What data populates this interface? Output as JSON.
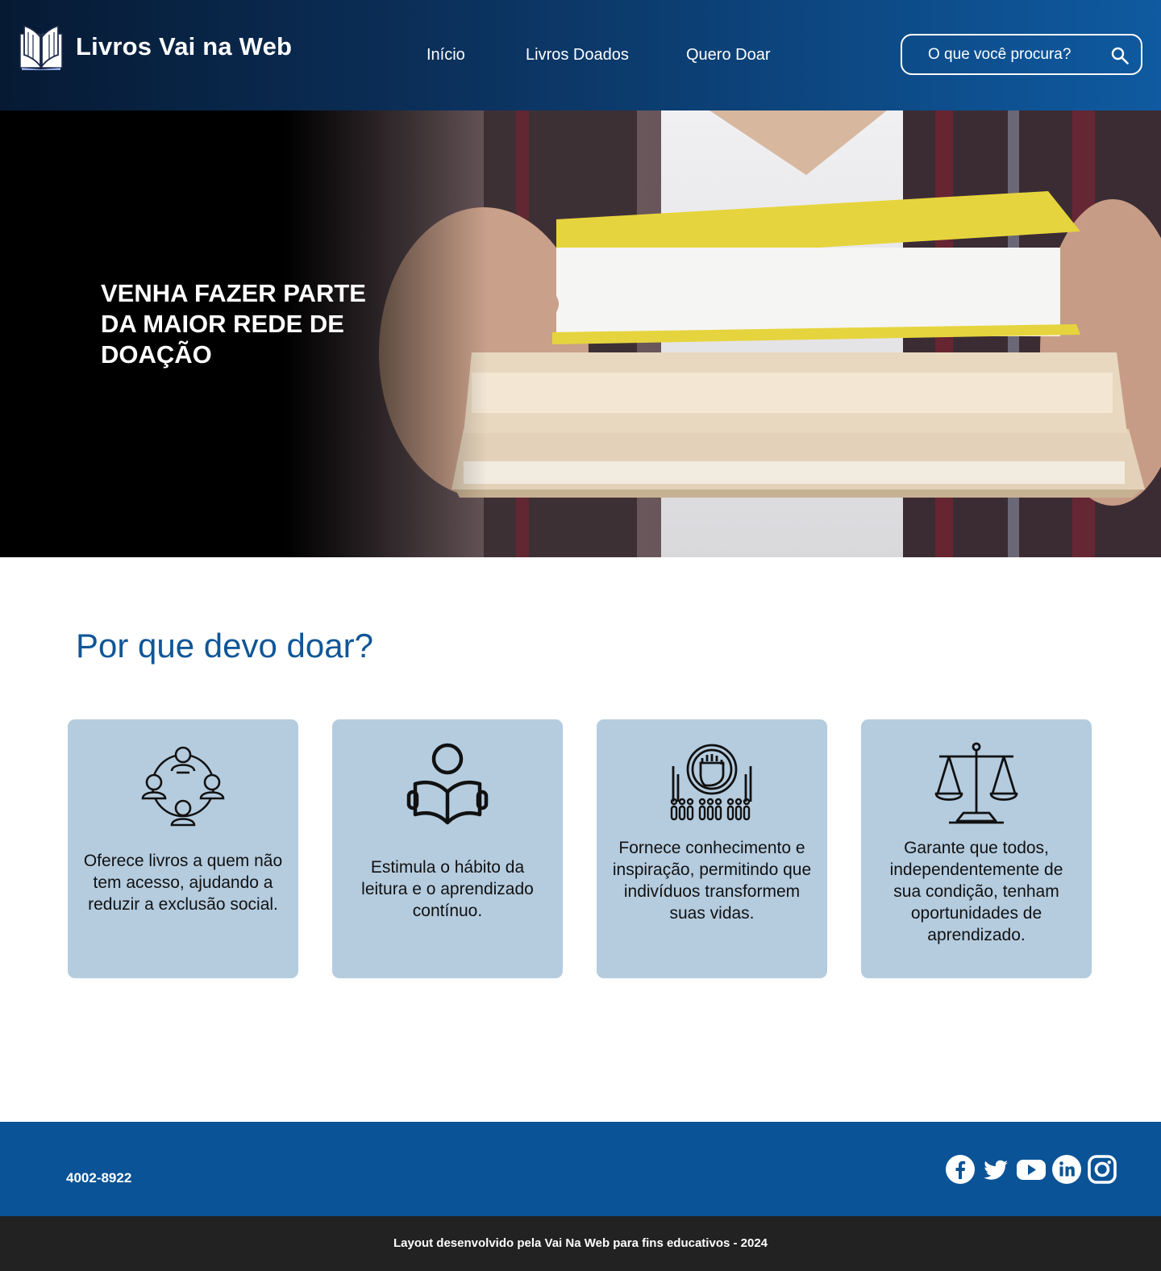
{
  "header": {
    "brand": "Livros Vai na Web",
    "nav": [
      "Início",
      "Livros Doados",
      "Quero Doar"
    ],
    "search_placeholder": "O que você procura?"
  },
  "hero": {
    "title": "VENHA FAZER PARTE DA MAIOR REDE DE DOAÇÃO"
  },
  "why": {
    "title": "Por que devo doar?",
    "cards": [
      {
        "icon": "community-network-icon",
        "text": "Oferece livros a quem não tem acesso, ajudando a reduzir a exclusão social."
      },
      {
        "icon": "reading-person-icon",
        "text": "Estimula o hábito da leitura e o aprendizado contínuo."
      },
      {
        "icon": "empowerment-fist-icon",
        "text": "Fornece conhecimento e inspiração, permitindo que indivíduos transformem suas vidas."
      },
      {
        "icon": "justice-scale-icon",
        "text": "Garante que todos, independentemente de sua condição, tenham oportunidades de aprendizado."
      }
    ]
  },
  "footer": {
    "phone": "4002-8922",
    "social": [
      "facebook-icon",
      "twitter-icon",
      "youtube-icon",
      "linkedin-icon",
      "instagram-icon"
    ],
    "credit": "Layout desenvolvido pela Vai Na Web para fins educativos - 2024"
  },
  "colors": {
    "header_dark": "#061a33",
    "header_light": "#0f5aa0",
    "card_bg": "#b5ccdf",
    "section_title": "#0f5697",
    "footer_bg": "#0a5396",
    "bottom_bar": "#222222"
  }
}
